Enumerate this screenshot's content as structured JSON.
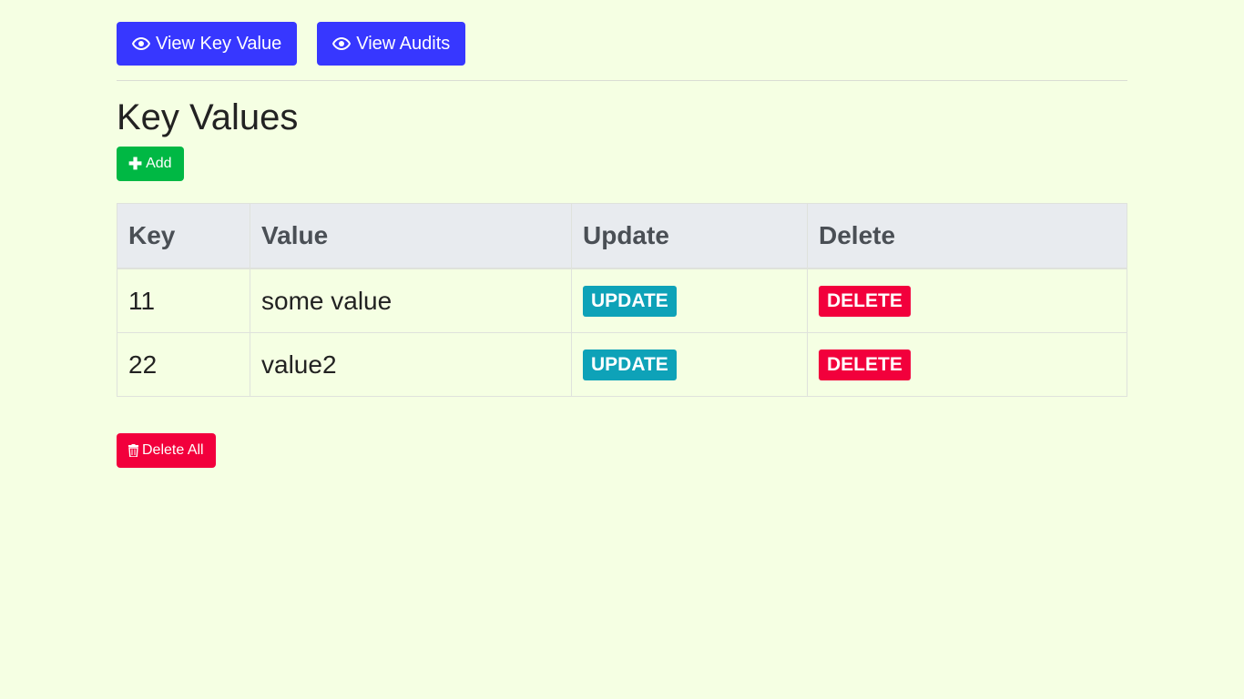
{
  "nav": {
    "view_key_value_label": "View Key Value",
    "view_key_value_icon": "eye-icon",
    "view_audits_label": "View Audits",
    "view_audits_icon": "eye-icon"
  },
  "page": {
    "title": "Key Values"
  },
  "actions": {
    "add_label": "Add",
    "add_icon": "plus-icon",
    "delete_all_label": "Delete All",
    "delete_all_icon": "trash-icon"
  },
  "table": {
    "headers": [
      "Key",
      "Value",
      "Update",
      "Delete"
    ],
    "rows": [
      {
        "key": "11",
        "value": "some value",
        "update_label": "UPDATE",
        "delete_label": "DELETE"
      },
      {
        "key": "22",
        "value": "value2",
        "update_label": "UPDATE",
        "delete_label": "DELETE"
      }
    ]
  },
  "colors": {
    "background": "#f5ffe3",
    "nav_button": "#3737ff",
    "add_button": "#00b844",
    "update_badge": "#0ea2b8",
    "delete_badge": "#f2003c"
  }
}
